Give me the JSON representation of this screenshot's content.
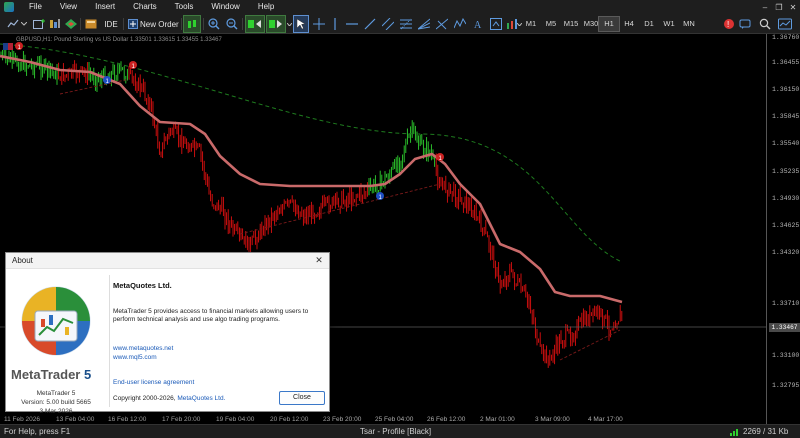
{
  "menu": [
    "File",
    "View",
    "Insert",
    "Charts",
    "Tools",
    "Window",
    "Help"
  ],
  "toolbar": {
    "ide_label": "IDE",
    "new_order_label": "New Order",
    "timeframes": [
      "M1",
      "M5",
      "M15",
      "M30",
      "H1",
      "H4",
      "D1",
      "W1",
      "MN"
    ],
    "active_timeframe": "H1"
  },
  "chart": {
    "legend": "GBPUSD,H1: Pound Sterling vs US Dollar  1.33501 1.33615 1.33455 1.33467",
    "price_labels": [
      "1.36760",
      "1.36455",
      "1.36150",
      "1.35845",
      "1.35540",
      "1.35235",
      "1.34930",
      "1.34625",
      "1.34320",
      "1.33710",
      "1.33405",
      "1.33100",
      "1.32795"
    ],
    "current_price": "1.33467",
    "time_labels": [
      "11 Feb 2026",
      "13 Feb 04:00",
      "16 Feb 12:00",
      "17 Feb 20:00",
      "19 Feb 04:00",
      "20 Feb 12:00",
      "23 Feb 20:00",
      "25 Feb 04:00",
      "26 Feb 12:00",
      "2 Mar 01:00",
      "3 Mar 09:00",
      "4 Mar 17:00"
    ],
    "colors": {
      "bull": "#2fd12f",
      "bear": "#e01010",
      "ma": "#c96a6a",
      "trend": "#1e7a1e"
    }
  },
  "status": {
    "help": "For Help, press F1",
    "profile": "Tsar - Profile [Black]",
    "traffic": "2269 / 31 Kb"
  },
  "about": {
    "title": "About",
    "wordmark_a": "MetaTrader",
    "wordmark_b": "5",
    "product": "MetaTrader 5",
    "version": "Version: 5.00 build 5665",
    "date": "3 Mar 2026",
    "company": "MetaQuotes Ltd.",
    "description": "MetaTrader 5 provides access to financial markets allowing users to perform technical analysis and use algo trading programs.",
    "link1": "www.metaquotes.net",
    "link2": "www.mql5.com",
    "eula": "End-user license agreement",
    "copyright_a": "Copyright 2000-2026,",
    "copyright_b": "MetaQuotes Ltd.",
    "close": "Close"
  }
}
